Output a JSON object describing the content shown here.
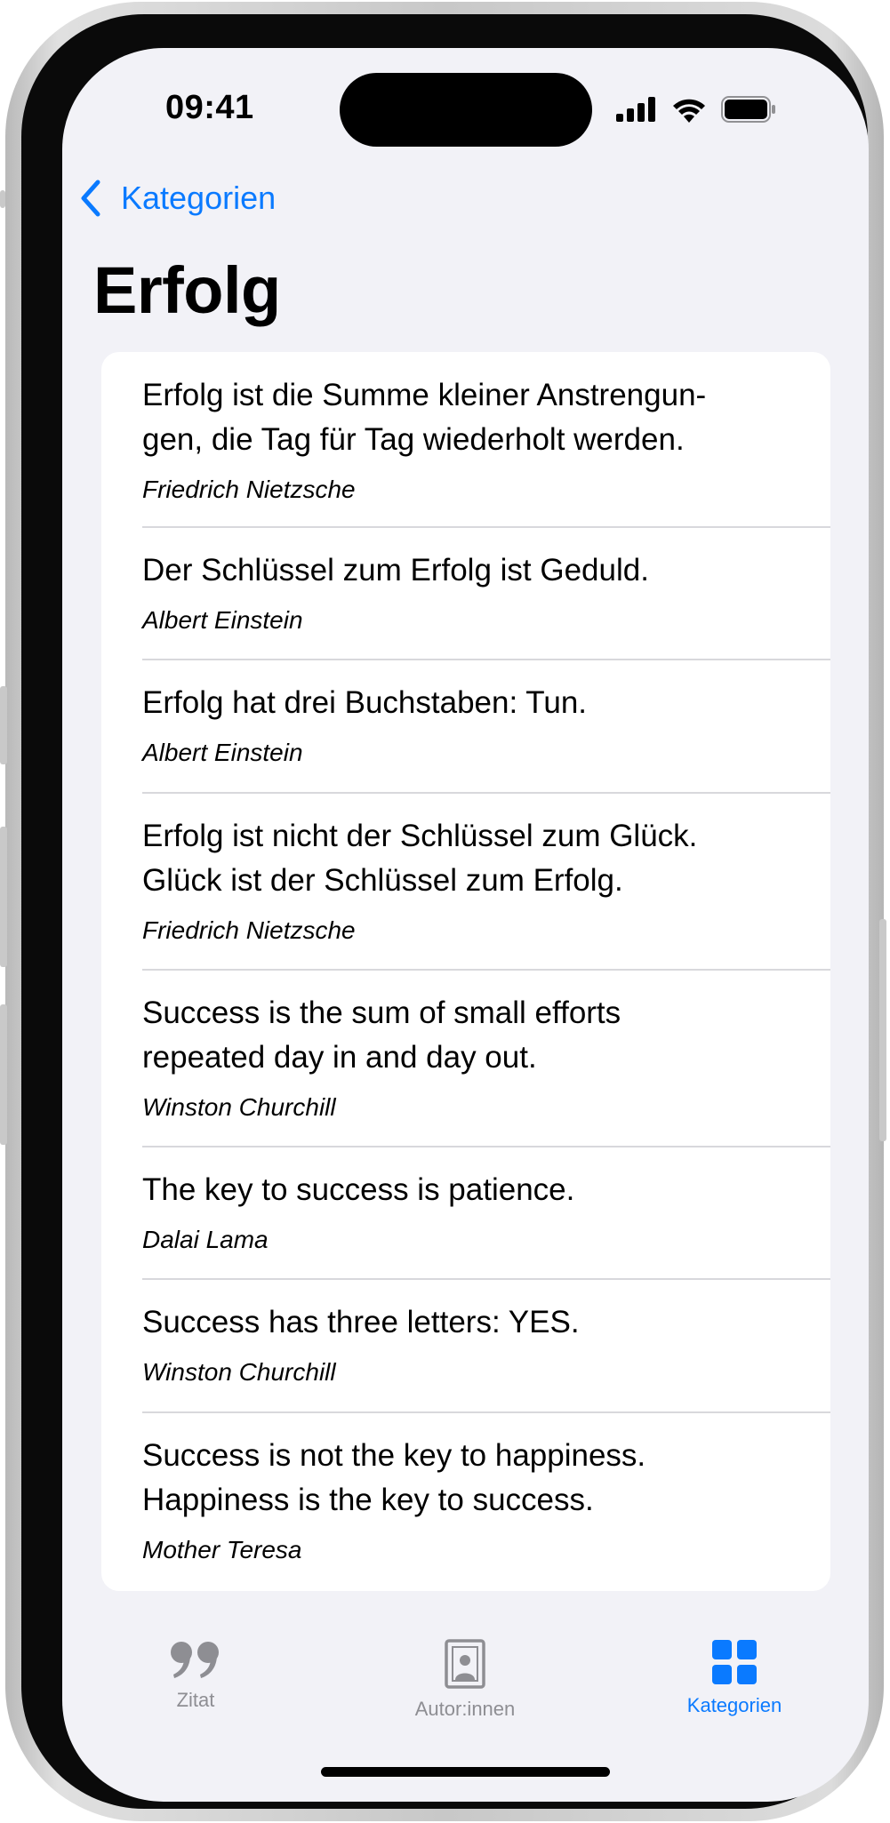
{
  "status_bar": {
    "time": "09:41"
  },
  "nav": {
    "back_label": "Kategorien",
    "title": "Erfolg"
  },
  "quotes": [
    {
      "lines": [
        "Erfolg ist die Summe kleiner Anstrengun-",
        "gen, die Tag für Tag wiederholt werden."
      ],
      "author": "Friedrich Nietzsche"
    },
    {
      "lines": [
        "Der Schlüssel zum Erfolg ist Geduld."
      ],
      "author": "Albert Einstein"
    },
    {
      "lines": [
        "Erfolg hat drei Buchstaben: Tun."
      ],
      "author": "Albert Einstein"
    },
    {
      "lines": [
        "Erfolg ist nicht der Schlüssel zum Glück.",
        "Glück ist der Schlüssel zum Erfolg."
      ],
      "author": "Friedrich Nietzsche"
    },
    {
      "lines": [
        "Success is the sum of small efforts",
        "repeated day in and day out."
      ],
      "author": "Winston Churchill"
    },
    {
      "lines": [
        "The key to success is patience."
      ],
      "author": "Dalai Lama"
    },
    {
      "lines": [
        "Success has three letters: YES."
      ],
      "author": "Winston Churchill"
    },
    {
      "lines": [
        "Success is not the key to happiness.",
        "Happiness is the key to success."
      ],
      "author": "Mother Teresa"
    }
  ],
  "tabbar": {
    "tabs": [
      {
        "label": "Zitat",
        "icon": "quote-icon",
        "active": false
      },
      {
        "label": "Autor:innen",
        "icon": "portrait-icon",
        "active": false
      },
      {
        "label": "Kategorien",
        "icon": "grid-icon",
        "active": true
      }
    ]
  },
  "colors": {
    "accent": "#0a7aff",
    "inactive": "#8e8e93",
    "background": "#f2f2f7",
    "card": "#ffffff"
  }
}
